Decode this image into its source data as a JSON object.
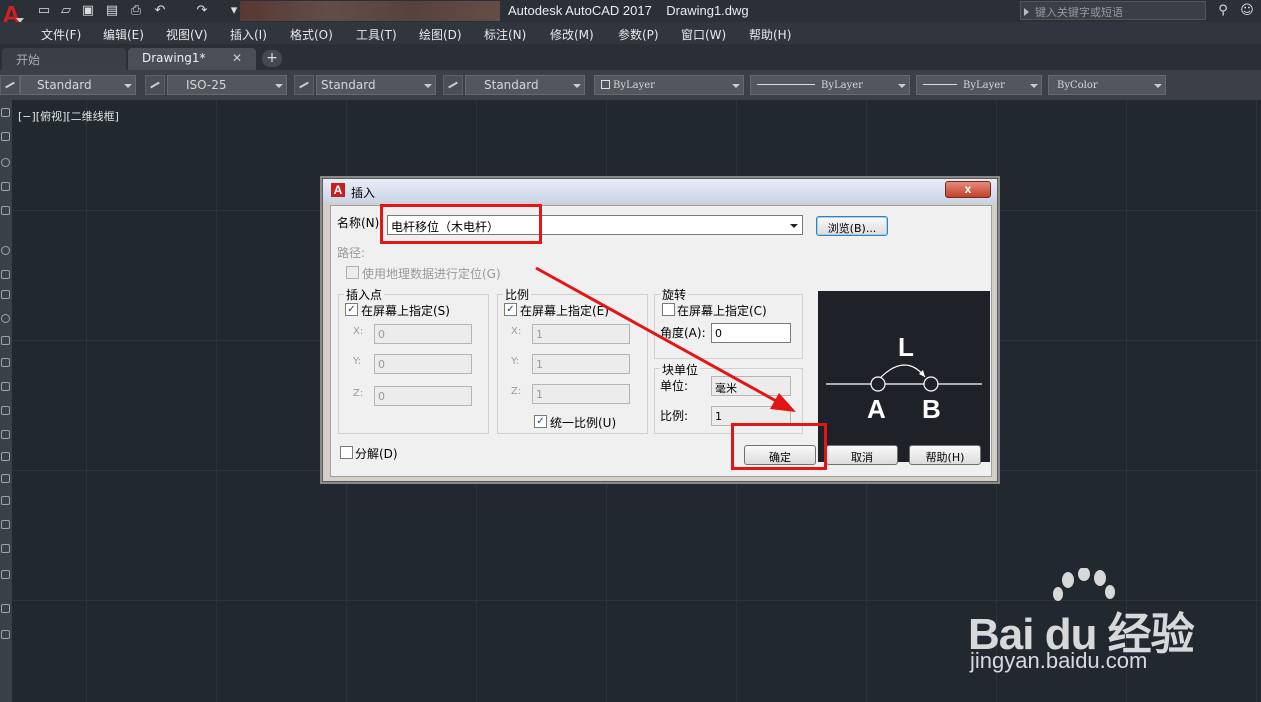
{
  "titlebar": {
    "title": "Autodesk AutoCAD 2017    Drawing1.dwg",
    "search_placeholder": "键入关键字或短语"
  },
  "menu": [
    "文件(F)",
    "编辑(E)",
    "视图(V)",
    "插入(I)",
    "格式(O)",
    "工具(T)",
    "绘图(D)",
    "标注(N)",
    "修改(M)",
    "参数(P)",
    "窗口(W)",
    "帮助(H)"
  ],
  "tabs": {
    "start": "开始",
    "drawing": "Drawing1*",
    "add": "+"
  },
  "stylebar": {
    "text_style": "Standard",
    "dim_style": "ISO-25",
    "table_style": "Standard",
    "multileader_style": "Standard",
    "layer_color": "ByLayer",
    "linetype": "ByLayer",
    "lineweight": "ByLayer",
    "plot_style": "ByColor"
  },
  "viewport_label": "[−][俯视][二维线框]",
  "dialog": {
    "title": "插入",
    "close": "x",
    "name_label": "名称(N):",
    "name_value": "电杆移位（木电杆）",
    "browse": "浏览(B)...",
    "path_label": "路径:",
    "geo_label": "使用地理数据进行定位(G)",
    "insert_point": {
      "title": "插入点",
      "onscreen": "在屏幕上指定(S)",
      "onscreen_checked": true,
      "x_label": "X:",
      "x": "0",
      "y_label": "Y:",
      "y": "0",
      "z_label": "Z:",
      "z": "0"
    },
    "scale": {
      "title": "比例",
      "onscreen": "在屏幕上指定(E)",
      "onscreen_checked": true,
      "x_label": "X:",
      "x": "1",
      "y_label": "Y:",
      "y": "1",
      "z_label": "Z:",
      "z": "1",
      "uniform": "统一比例(U)",
      "uniform_checked": true
    },
    "rotation": {
      "title": "旋转",
      "onscreen": "在屏幕上指定(C)",
      "onscreen_checked": false,
      "angle_label": "角度(A):",
      "angle": "0"
    },
    "block_unit": {
      "title": "块单位",
      "unit_label": "单位:",
      "unit": "毫米",
      "factor_label": "比例:",
      "factor": "1"
    },
    "explode": "分解(D)",
    "explode_checked": false,
    "ok": "确定",
    "cancel": "取消",
    "help": "帮助(H)",
    "preview": {
      "label_top": "L",
      "label_a": "A",
      "label_b": "B"
    }
  },
  "watermark": {
    "brand": "Bai  du 经验",
    "url": "jingyan.baidu.com"
  }
}
